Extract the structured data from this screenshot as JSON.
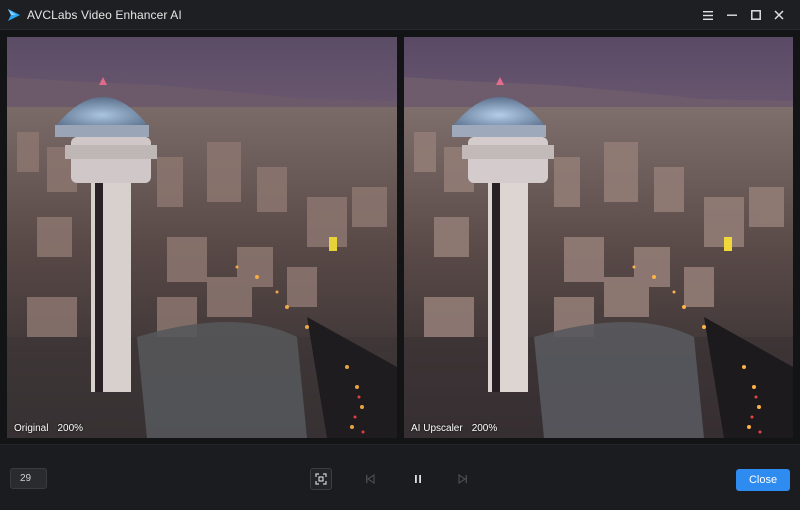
{
  "window": {
    "title": "AVCLabs Video Enhancer AI",
    "logo_icon": "avclabs-logo-icon",
    "menu_icon": "hamburger-menu-icon",
    "minimize_icon": "minimize-icon",
    "maximize_icon": "maximize-icon",
    "close_icon": "close-icon"
  },
  "preview": {
    "left": {
      "label": "Original",
      "zoom": "200%"
    },
    "right": {
      "label": "AI Upscaler",
      "zoom": "200%"
    }
  },
  "controls": {
    "frame_value": "29",
    "fit_icon": "fit-screen-icon",
    "prev_icon": "skip-previous-icon",
    "pause_icon": "pause-icon",
    "next_icon": "skip-next-icon",
    "close_label": "Close"
  },
  "colors": {
    "accent": "#2e8bf0",
    "background": "#1b1c1f"
  }
}
